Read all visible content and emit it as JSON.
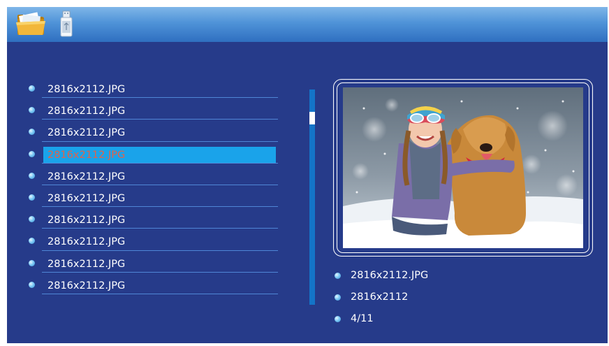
{
  "toolbar": {
    "icons": [
      "folder-icon",
      "usb-drive-icon"
    ]
  },
  "file_list": {
    "items": [
      {
        "label": "2816x2112.JPG",
        "selected": false
      },
      {
        "label": "2816x2112.JPG",
        "selected": false
      },
      {
        "label": "2816x2112.JPG",
        "selected": false
      },
      {
        "label": "2816x2112.JPG",
        "selected": true
      },
      {
        "label": "2816x2112.JPG",
        "selected": false
      },
      {
        "label": "2816x2112.JPG",
        "selected": false
      },
      {
        "label": "2816x2112.JPG",
        "selected": false
      },
      {
        "label": "2816x2112.JPG",
        "selected": false
      },
      {
        "label": "2816x2112.JPG",
        "selected": false
      },
      {
        "label": "2816x2112.JPG",
        "selected": false
      }
    ],
    "scroll_position": 0.11
  },
  "preview": {
    "image": "photo-thumbnail: girl in winter hat with golden retriever in snow"
  },
  "info": {
    "filename": "2816x2112.JPG",
    "resolution": "2816x2112",
    "index": "4/11"
  },
  "colors": {
    "background": "#263b8a",
    "selection": "#1aa3ea",
    "selected_text": "#e1624a",
    "scrollbar": "#1474c8"
  }
}
